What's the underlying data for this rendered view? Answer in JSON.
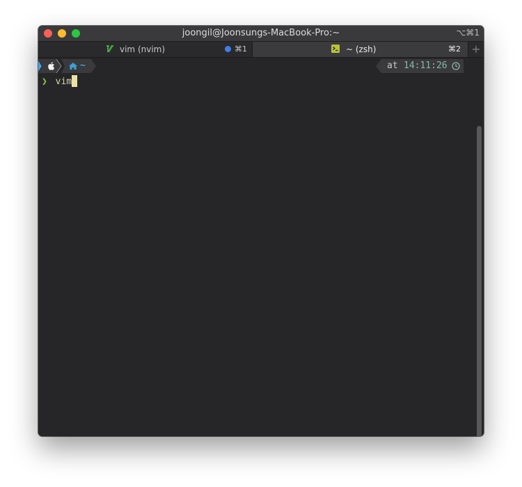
{
  "window": {
    "title": "joongil@Joonsungs-MacBook-Pro:~",
    "shortcut": "⌥⌘1"
  },
  "tabs": [
    {
      "label": "vim (nvim)",
      "shortcut": "⌘1",
      "icon": "vim-icon",
      "has_activity_dot": true
    },
    {
      "label": "~ (zsh)",
      "shortcut": "⌘2",
      "icon": "terminal-icon",
      "active": true
    }
  ],
  "new_tab_label": "+",
  "prompt": {
    "os_icon": "apple-icon",
    "home_icon": "home-icon",
    "dir": "~",
    "time_prefix": "at",
    "time": "14:11:26",
    "clock_icon": "clock-icon"
  },
  "command": {
    "prompt_symbol": "❯",
    "text": "vim"
  },
  "colors": {
    "window_bg": "#262628",
    "titlebar": "#3a3a3c",
    "accent_blue": "#3f7fe8",
    "prompt_green": "#89d04a",
    "time_green": "#8bb7a6",
    "home_blue": "#3ca0d8"
  }
}
